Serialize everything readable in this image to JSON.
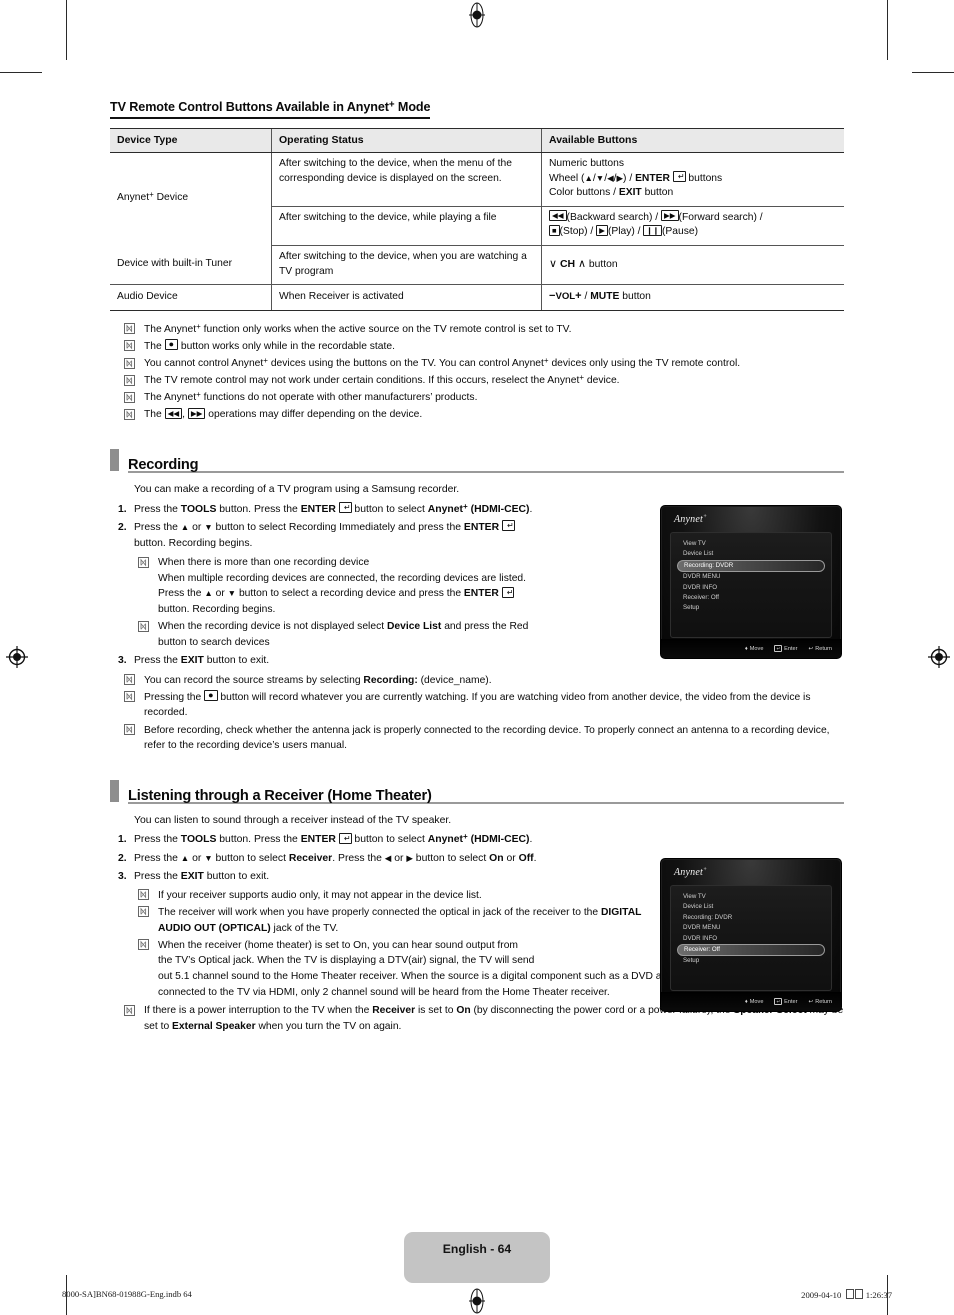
{
  "doc": {
    "heading": "TV Remote Control Buttons Available in Anynet",
    "heading_sup": "+",
    "heading_tail": " Mode"
  },
  "table": {
    "headers": [
      "Device Type",
      "Operating Status",
      "Available Buttons"
    ],
    "rows": [
      {
        "device": "Anynet",
        "device_sup": "+",
        "device_tail": " Device",
        "status": "After switching to the device, when the menu of the corresponding device is displayed on the screen.",
        "buttons_lines": [
          "Numeric buttons",
          "Wheel (▲/▼/◀/▶) / ENTER buttons",
          "Color buttons / EXIT button"
        ]
      },
      {
        "status": "After switching to the device, while playing a file",
        "buttons_lines": [
          "(Backward search) / (Forward search) /",
          "(Stop) / (Play) / (Pause)"
        ]
      },
      {
        "device": "Device with built-in Tuner",
        "status": "After switching to the device, when you are watching a TV program",
        "buttons": "CH button",
        "buttons_ch": "CH",
        "buttons_suffix": "button"
      },
      {
        "device": "Audio Device",
        "status": "When Receiver is activated",
        "vol": "VOL",
        "mute": "MUTE",
        "buttons_suffix": "button"
      }
    ]
  },
  "top_notes": [
    "The Anynet+ function only works when the active source on the TV remote control is set to TV.",
    "The ● button works only while in the recordable state.",
    "You cannot control Anynet+ devices using the buttons on the TV. You can control Anynet+ devices only using the TV remote control.",
    "The TV remote control may not work under certain conditions. If this occurs, reselect the Anynet+ device.",
    "The Anynet+ functions do not operate with other manufacturers’ products.",
    "The ◀◀, ▶▶ operations may differ depending on the device."
  ],
  "recording": {
    "title": "Recording",
    "lead": "You can make a recording of a TV program using a Samsung recorder.",
    "steps": [
      {
        "num": "1.",
        "text": "Press the TOOLS button. Press the ENTER button to select Anynet+ (HDMI-CEC)."
      },
      {
        "num": "2.",
        "text": "Press the ▲ or ▼ button to select Recording Immediately and press the ENTER button. Recording begins."
      },
      {
        "num": "3.",
        "text": "Press the EXIT button to exit."
      }
    ],
    "step2_notes": [
      {
        "line1": "When there is more than one recording device",
        "line2": "When multiple recording devices are connected, the recording devices are listed.",
        "line3": "Press the ▲ or ▼ button to select a recording device and press the ENTER",
        "line4": "button. Recording begins."
      },
      {
        "line1": "When the recording device is not displayed select Device List and press the Red",
        "line2": "button to search devices"
      }
    ],
    "end_notes": [
      "You can record the source streams by selecting Recording: (device_name).",
      "Pressing the ● button will record whatever you are currently watching. If you are watching video from another device, the video from the device is recorded.",
      "Before recording, check whether the antenna jack is properly connected to the recording device. To properly connect an antenna to a recording device, refer to the recording device’s users manual."
    ]
  },
  "receiver": {
    "title": "Listening through a Receiver (Home Theater)",
    "lead": "You can listen to sound through a receiver instead of the TV speaker.",
    "steps": [
      {
        "num": "1.",
        "text": "Press the TOOLS button. Press the ENTER button to select Anynet+ (HDMI-CEC)."
      },
      {
        "num": "2.",
        "text": "Press the ▲ or ▼ button to select Receiver. Press the ◀ or ▶ button to select On or Off."
      },
      {
        "num": "3.",
        "text": "Press the EXIT button to exit."
      }
    ],
    "notes": [
      "If your receiver supports audio only, it may not appear in the device list.",
      "The receiver will work when you have properly connected the optical in jack of the receiver to the DIGITAL AUDIO OUT (OPTICAL) jack of the TV.",
      "When the receiver (home theater) is set to On, you can hear sound output from the TV’s Optical jack. When the TV is displaying a DTV(air) signal, the TV will send out 5.1 channel sound to the Home Theater receiver. When the source is a digital component such as a DVD and is connected to the TV via HDMI, only 2 channel sound will be heard from the Home Theater receiver.",
      "If there is a power interruption to the TV when the Receiver is set to On (by disconnecting the power cord or a power failure), the Speaker Select may be set to External Speaker when you turn the TV on again."
    ]
  },
  "tv_screens": [
    {
      "logo": "Anynet",
      "logo_sup": "+",
      "items": [
        "View TV",
        "Device List",
        "Recording: DVDR",
        "DVDR MENU",
        "DVDR INFO",
        "Receiver: Off",
        "Setup"
      ],
      "selected_index": 2,
      "footer": [
        {
          "glyph": "♣",
          "label": "Move"
        },
        {
          "glyph": "",
          "label": "Enter"
        },
        {
          "glyph": "↶",
          "label": "Return"
        }
      ]
    },
    {
      "logo": "Anynet",
      "logo_sup": "+",
      "items": [
        "View TV",
        "Device List",
        "Recording: DVDR",
        "DVDR MENU",
        "DVDR INFO",
        "Receiver: Off",
        "Setup"
      ],
      "selected_index": 5,
      "footer": [
        {
          "glyph": "♣",
          "label": "Move"
        },
        {
          "glyph": "",
          "label": "Enter"
        },
        {
          "glyph": "↶",
          "label": "Return"
        }
      ]
    }
  ],
  "footer": {
    "page_label": "English - 64",
    "file_info": "8000-SA]BN68-01988G-Eng.indb   64",
    "date": "2009-04-10",
    "time": "1:26:37"
  }
}
